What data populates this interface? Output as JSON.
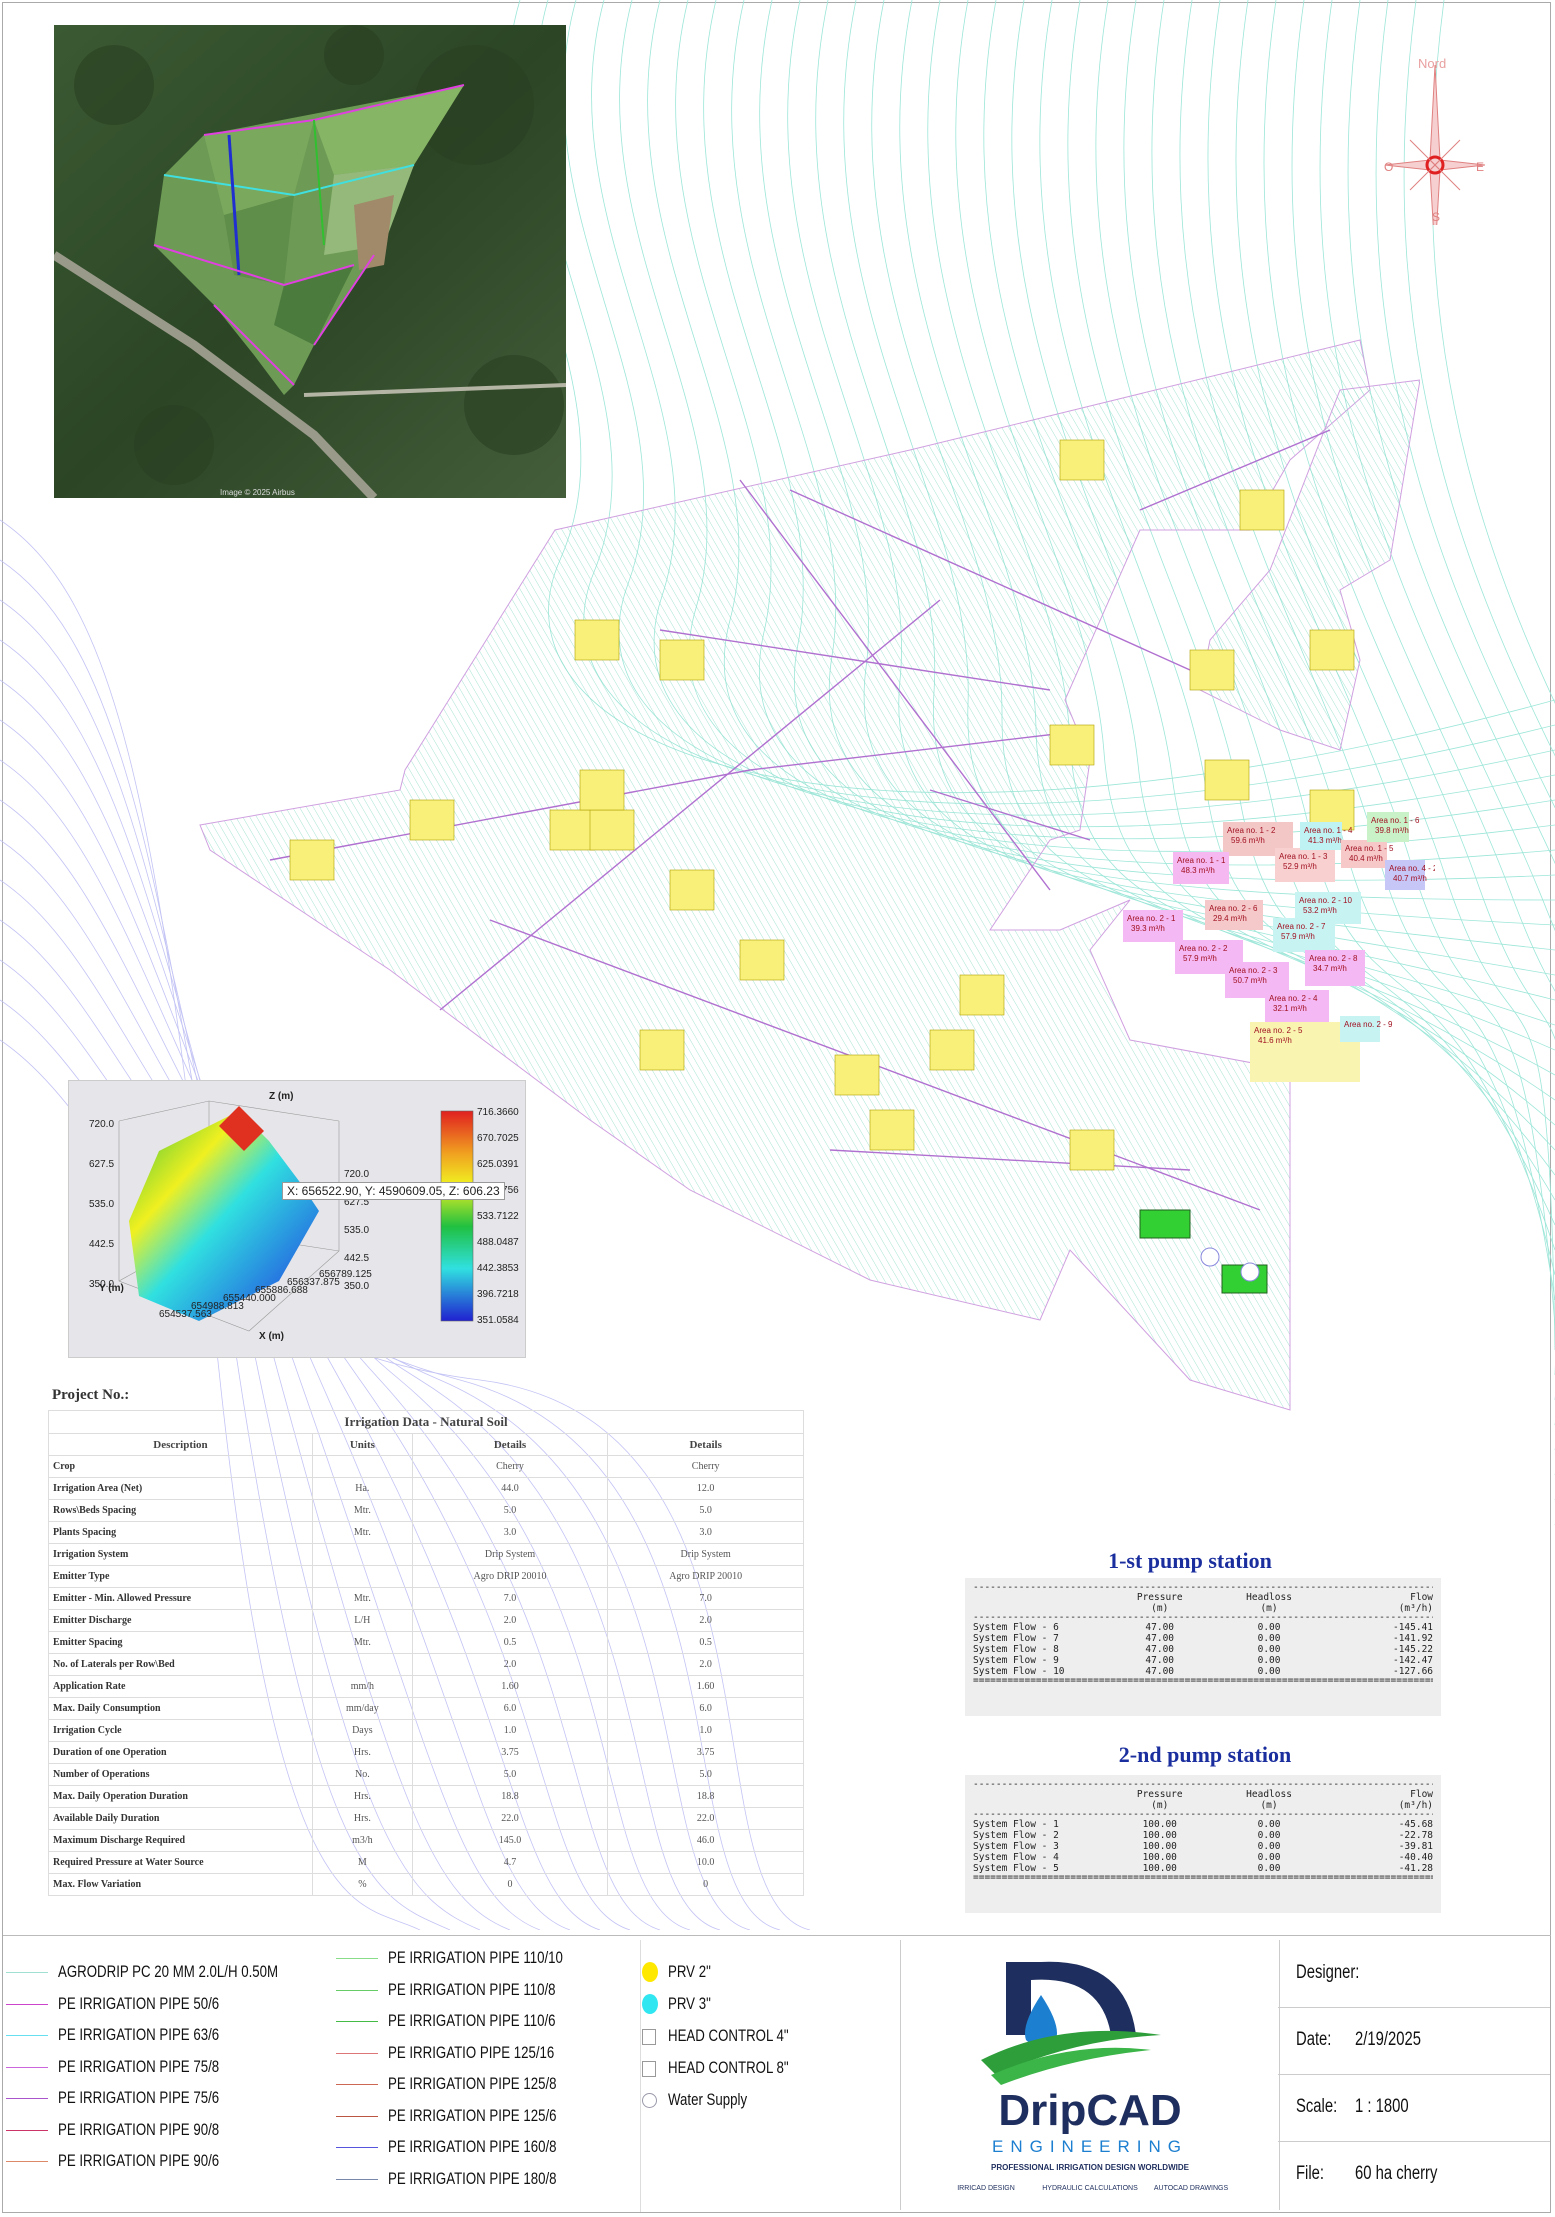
{
  "map": {
    "north_label": "Nord",
    "dir_w": "O",
    "dir_e": "E",
    "dir_s": "S",
    "satellite_caption": "Image © 2025 Airbus",
    "zones": [
      {
        "label": "Area no. 1 - 2",
        "flow": "59.6 m³/h",
        "color": "#f4c7c7"
      },
      {
        "label": "Area no. 1 - 1",
        "flow": "48.3 m³/h",
        "color": "#f6b8f1"
      },
      {
        "label": "Area no. 1 - 3",
        "flow": "52.9 m³/h",
        "color": "#f8d0d0"
      },
      {
        "label": "Area no. 1 - 4",
        "flow": "41.3 m³/h",
        "color": "#bff3f3"
      },
      {
        "label": "Area no. 1 - 5",
        "flow": "40.4 m³/h",
        "color": "#f6c8c8"
      },
      {
        "label": "Area no. 1 - 6",
        "flow": "39.8 m³/h",
        "color": "#c9f2c9"
      },
      {
        "label": "Area no. 4 - 2",
        "flow": "40.7 m³/h",
        "color": "#c6c6f7"
      },
      {
        "label": "Area no. 2 - 1",
        "flow": "39.3 m³/h",
        "color": "#f4b8f4"
      },
      {
        "label": "Area no. 2 - 6",
        "flow": "29.4 m³/h",
        "color": "#f5c9c9"
      },
      {
        "label": "Area no. 2 - 10",
        "flow": "53.2 m³/h",
        "color": "#c7f3f3"
      },
      {
        "label": "Area no. 2 - 2",
        "flow": "57.9 m³/h",
        "color": "#f4b8f4"
      },
      {
        "label": "Area no. 2 - 7",
        "flow": "57.9 m³/h",
        "color": "#c7f3f3"
      },
      {
        "label": "Area no. 2 - 3",
        "flow": "50.7 m³/h",
        "color": "#f4b8f4"
      },
      {
        "label": "Area no. 2 - 8",
        "flow": "34.7 m³/h",
        "color": "#f4b8f4"
      },
      {
        "label": "Area no. 2 - 4",
        "flow": "32.1 m³/h",
        "color": "#f4b8f4"
      },
      {
        "label": "Area no. 2 - 5",
        "flow": "41.6 m³/h",
        "color": "#f9f5b0"
      },
      {
        "label": "Area no. 2 - 9",
        "flow": "",
        "color": "#c7f3f3"
      }
    ]
  },
  "plot3d": {
    "z_axis": "Z (m)",
    "x_axis": "X (m)",
    "y_axis": "Y (m)",
    "tooltip": "X: 656522.90, Y: 4590609.05, Z: 606.23",
    "z_ticks": [
      "720.0",
      "627.5",
      "535.0",
      "442.5",
      "350.0"
    ],
    "z_ticks_right": [
      "720.0",
      "627.5",
      "535.0",
      "442.5",
      "350.0"
    ],
    "x_ticks": [
      "654537.563",
      "654988.813",
      "655440.000",
      "655886.688",
      "656337.875",
      "656789.125"
    ],
    "colorbar": [
      "716.3660",
      "670.7025",
      "625.0391",
      "579.3756",
      "533.7122",
      "488.0487",
      "442.3853",
      "396.7218",
      "351.0584"
    ]
  },
  "project": {
    "label": "Project No.:"
  },
  "irrigation_table": {
    "title": "Irrigation Data - Natural Soil",
    "headers": [
      "Description",
      "Units",
      "Details",
      "Details"
    ],
    "rows": [
      [
        "Crop",
        "",
        "Cherry",
        "Cherry"
      ],
      [
        "Irrigation Area (Net)",
        "Ha.",
        "44.0",
        "12.0"
      ],
      [
        "Rows\\Beds Spacing",
        "Mtr.",
        "5.0",
        "5.0"
      ],
      [
        "Plants Spacing",
        "Mtr.",
        "3.0",
        "3.0"
      ],
      [
        "Irrigation System",
        "",
        "Drip System",
        "Drip System"
      ],
      [
        "Emitter Type",
        "",
        "Agro DRIP 20010",
        "Agro DRIP 20010"
      ],
      [
        "Emitter - Min. Allowed Pressure",
        "Mtr.",
        "7.0",
        "7.0"
      ],
      [
        "Emitter Discharge",
        "L/H",
        "2.0",
        "2.0"
      ],
      [
        "Emitter Spacing",
        "Mtr.",
        "0.5",
        "0.5"
      ],
      [
        "No. of Laterals per Row\\Bed",
        "",
        "2.0",
        "2.0"
      ],
      [
        "Application Rate",
        "mm/h",
        "1.60",
        "1.60"
      ],
      [
        "Max. Daily Consumption",
        "mm/day",
        "6.0",
        "6.0"
      ],
      [
        "Irrigation Cycle",
        "Days",
        "1.0",
        "1.0"
      ],
      [
        "Duration of one Operation",
        "Hrs.",
        "3.75",
        "3.75"
      ],
      [
        "Number of Operations",
        "No.",
        "5.0",
        "5.0"
      ],
      [
        "Max. Daily Operation Duration",
        "Hrs.",
        "18.8",
        "18.8"
      ],
      [
        "Available Daily Duration",
        "Hrs.",
        "22.0",
        "22.0"
      ],
      [
        "Maximum Discharge Required",
        "m3/h",
        "145.0",
        "46.0"
      ],
      [
        "Required Pressure at Water Source",
        "M",
        "4.7",
        "10.0"
      ],
      [
        "Max. Flow Variation",
        "%",
        "0",
        "0"
      ]
    ]
  },
  "pump1": {
    "title": "1-st pump station",
    "h_pressure": "Pressure",
    "h_headloss": "Headloss",
    "h_flow": "Flow",
    "u_pressure": "(m)",
    "u_headloss": "(m)",
    "u_flow": "(m³/h)",
    "rows": [
      [
        "System Flow - 6",
        "47.00",
        "0.00",
        "-145.41"
      ],
      [
        "System Flow - 7",
        "47.00",
        "0.00",
        "-141.92"
      ],
      [
        "System Flow - 8",
        "47.00",
        "0.00",
        "-145.22"
      ],
      [
        "System Flow - 9",
        "47.00",
        "0.00",
        "-142.47"
      ],
      [
        "System Flow - 10",
        "47.00",
        "0.00",
        "-127.66"
      ]
    ]
  },
  "pump2": {
    "title": "2-nd pump station",
    "h_pressure": "Pressure",
    "h_headloss": "Headloss",
    "h_flow": "Flow",
    "u_pressure": "(m)",
    "u_headloss": "(m)",
    "u_flow": "(m³/h)",
    "rows": [
      [
        "System Flow - 1",
        "100.00",
        "0.00",
        "-45.68"
      ],
      [
        "System Flow - 2",
        "100.00",
        "0.00",
        "-22.78"
      ],
      [
        "System Flow - 3",
        "100.00",
        "0.00",
        "-39.81"
      ],
      [
        "System Flow - 4",
        "100.00",
        "0.00",
        "-40.40"
      ],
      [
        "System Flow - 5",
        "100.00",
        "0.00",
        "-41.28"
      ]
    ]
  },
  "legend": {
    "col1": [
      {
        "label": "AGRODRIP PC 20 MM 2.0L/H 0.50M",
        "color": "#9fe0d2"
      },
      {
        "label": "PE IRRIGATION PIPE 50/6",
        "color": "#cc44cc"
      },
      {
        "label": "PE IRRIGATION PIPE 63/6",
        "color": "#66e0f0"
      },
      {
        "label": "PE IRRIGATION PIPE 75/8",
        "color": "#cc66dd"
      },
      {
        "label": "PE IRRIGATION PIPE 75/6",
        "color": "#aa55cc"
      },
      {
        "label": "PE IRRIGATION PIPE 90/8",
        "color": "#cc3366"
      },
      {
        "label": "PE IRRIGATION PIPE 90/6",
        "color": "#dd8866"
      }
    ],
    "col2": [
      {
        "label": "PE IRRIGATION PIPE 110/10",
        "color": "#88dd88"
      },
      {
        "label": "PE IRRIGATION PIPE 110/8",
        "color": "#66cc66"
      },
      {
        "label": "PE IRRIGATION PIPE 110/6",
        "color": "#44bb44"
      },
      {
        "label": "PE IRRIGATIO PIPE 125/16",
        "color": "#dd7777"
      },
      {
        "label": "PE IRRIGATION PIPE 125/8",
        "color": "#cc6655"
      },
      {
        "label": "PE IRRIGATION PIPE 125/6",
        "color": "#bb5544"
      },
      {
        "label": "PE IRRIGATION PIPE 160/8",
        "color": "#5555dd"
      },
      {
        "label": "PE IRRIGATION PIPE 180/8",
        "color": "#7788aa"
      }
    ],
    "col3": [
      {
        "label": "PRV 2\"",
        "symbol": "yellow-dot"
      },
      {
        "label": "PRV 3\"",
        "symbol": "cyan-dot"
      },
      {
        "label": "HEAD CONTROL 4\"",
        "symbol": "box"
      },
      {
        "label": "HEAD CONTROL 8\"",
        "symbol": "box"
      },
      {
        "label": "Water Supply",
        "symbol": "w-circle"
      }
    ]
  },
  "brand": {
    "name": "DripCAD",
    "sub": "ENGINEERING",
    "tagline": "PROFESSIONAL IRRIGATION DESIGN WORLDWIDE",
    "services": [
      "IRRICAD DESIGN",
      "HYDRAULIC CALCULATIONS",
      "AUTOCAD DRAWINGS"
    ]
  },
  "info": {
    "designer_label": "Designer:",
    "designer": "",
    "date_label": "Date:",
    "date": "2/19/2025",
    "scale_label": "Scale:",
    "scale": "1 : 1800",
    "file_label": "File:",
    "file": "60 ha cherry"
  },
  "colors": {
    "pump_title": "#1b2e9e",
    "brand_navy": "#1e2e5e",
    "brand_blue": "#1d7fd0",
    "brand_green": "#2e9e3a"
  }
}
